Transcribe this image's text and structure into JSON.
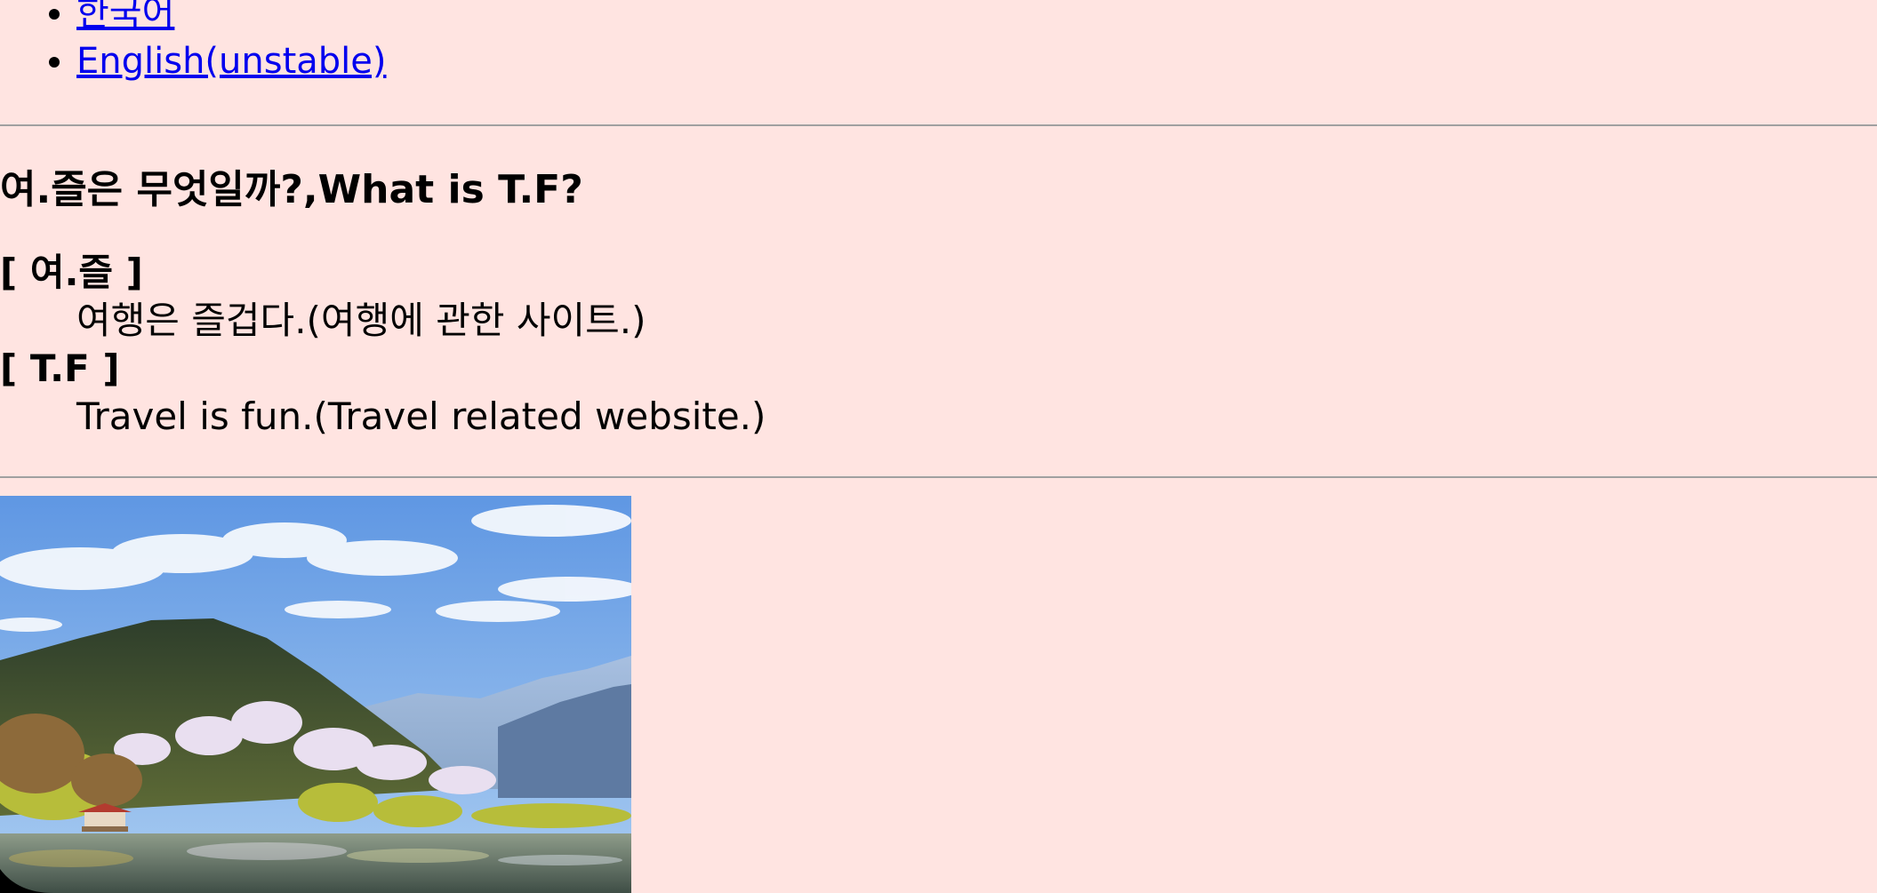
{
  "languages": [
    {
      "label": "한국어"
    },
    {
      "label": "English(unstable)"
    }
  ],
  "title": "여.즐은 무엇일까?,What is T.F?",
  "definitions": [
    {
      "term": "[ 여.즐 ]",
      "description": "여행은 즐겁다.(여행에 관한 사이트.)"
    },
    {
      "term": "[ T.F ]",
      "description": "Travel is fun.(Travel related website.)"
    }
  ],
  "colors": {
    "background": "#ffe4e1",
    "link": "#0000ee",
    "rule": "#a0a0a0"
  }
}
